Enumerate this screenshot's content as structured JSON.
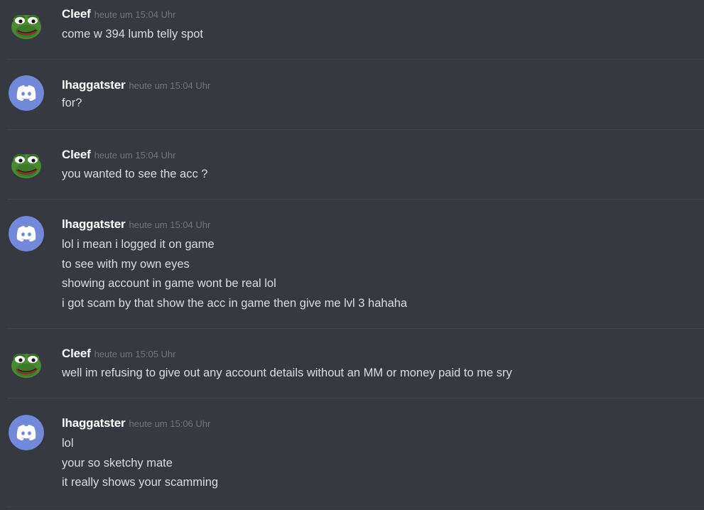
{
  "colors": {
    "background": "#36393f",
    "divider": "#40444b",
    "username": "#ffffff",
    "timestamp": "#72767d",
    "message_text": "#dcddde",
    "discord_blurple": "#7289da"
  },
  "messages": [
    {
      "author": "Cleef",
      "avatar_icon": "pepe-frog-icon",
      "timestamp": "heute um 15:04 Uhr",
      "lines": [
        "come w 394 lumb telly spot"
      ]
    },
    {
      "author": "lhaggatster",
      "avatar_icon": "discord-logo-icon",
      "timestamp": "heute um 15:04 Uhr",
      "lines": [
        "for?"
      ]
    },
    {
      "author": "Cleef",
      "avatar_icon": "pepe-frog-icon",
      "timestamp": "heute um 15:04 Uhr",
      "lines": [
        "you wanted to see the acc ?"
      ]
    },
    {
      "author": "lhaggatster",
      "avatar_icon": "discord-logo-icon",
      "timestamp": "heute um 15:04 Uhr",
      "lines": [
        "lol i mean i logged it on game",
        "to see with my own eyes",
        "showing account in game wont be real lol",
        "i got scam by that show the acc in game then give me lvl 3 hahaha"
      ]
    },
    {
      "author": "Cleef",
      "avatar_icon": "pepe-frog-icon",
      "timestamp": "heute um 15:05 Uhr",
      "lines": [
        "well im refusing to give out any account details without an MM or money paid to me sry"
      ]
    },
    {
      "author": "lhaggatster",
      "avatar_icon": "discord-logo-icon",
      "timestamp": "heute um 15:06 Uhr",
      "lines": [
        "lol",
        "your so sketchy mate",
        "it really shows your scamming"
      ]
    }
  ]
}
